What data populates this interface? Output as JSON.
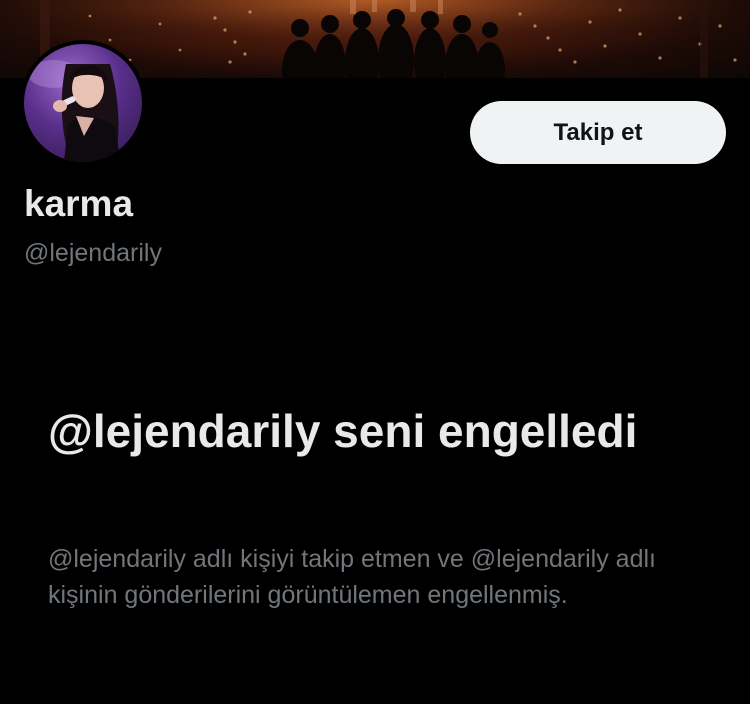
{
  "profile": {
    "display_name": "karma",
    "handle": "@lejendarily",
    "follow_label": "Takip et"
  },
  "blocked": {
    "title": "@lejendarily seni engelledi",
    "description": "@lejendarily adlı kişiyi takip etmen ve @lejendarily adlı kişinin gönderilerini görüntülemen engellenmiş."
  },
  "colors": {
    "background": "#000000",
    "primary_text": "#e7e9ea",
    "secondary_text": "#71767b",
    "button_bg": "#eff3f4",
    "button_text": "#0f1419"
  }
}
